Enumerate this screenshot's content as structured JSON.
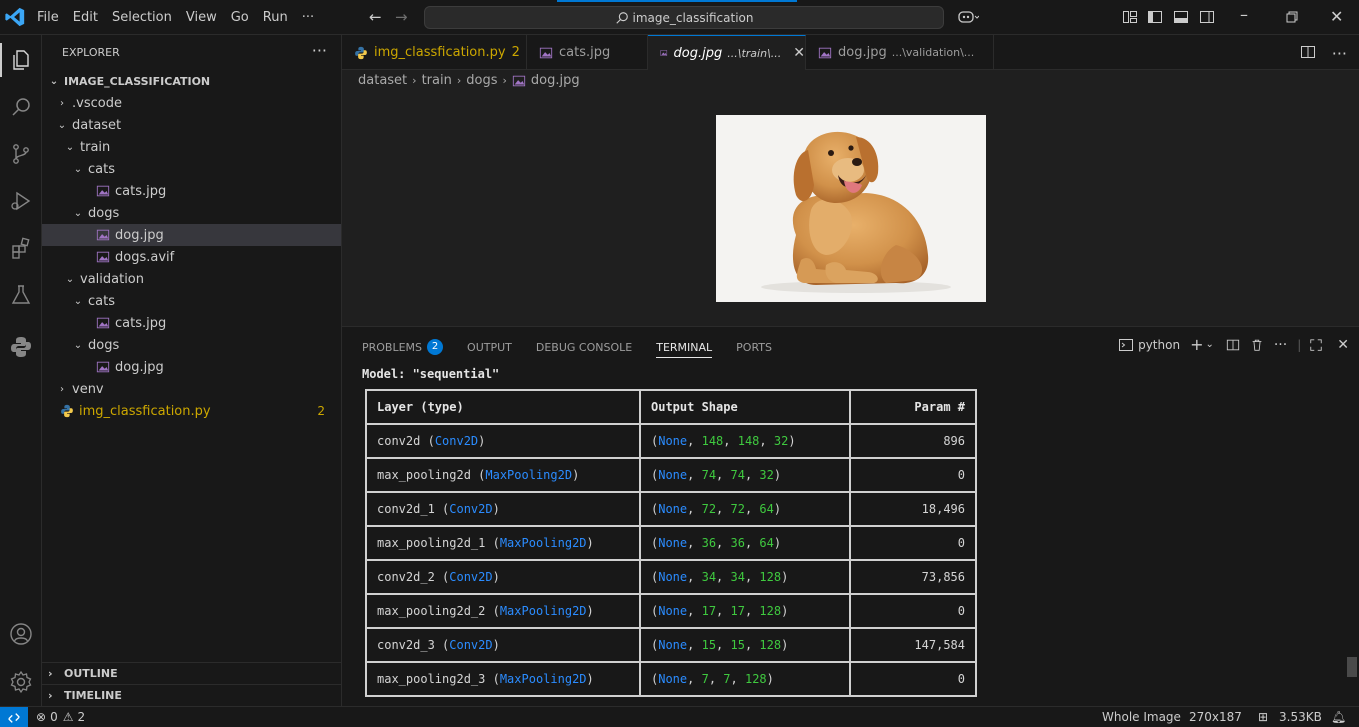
{
  "menu": [
    "File",
    "Edit",
    "Selection",
    "View",
    "Go",
    "Run",
    "···"
  ],
  "command_center": "image_classification",
  "explorer": {
    "header": "EXPLORER",
    "root": "IMAGE_CLASSIFICATION",
    "items": [
      {
        "label": ".vscode",
        "type": "folder",
        "open": false
      },
      {
        "label": "dataset",
        "type": "folder",
        "open": true
      },
      {
        "label": "train",
        "type": "folder",
        "open": true
      },
      {
        "label": "cats",
        "type": "folder",
        "open": true
      },
      {
        "label": "cats.jpg",
        "type": "image"
      },
      {
        "label": "dogs",
        "type": "folder",
        "open": true
      },
      {
        "label": "dog.jpg",
        "type": "image",
        "selected": true
      },
      {
        "label": "dogs.avif",
        "type": "image"
      },
      {
        "label": "validation",
        "type": "folder",
        "open": true
      },
      {
        "label": "cats",
        "type": "folder",
        "open": true
      },
      {
        "label": "cats.jpg",
        "type": "image"
      },
      {
        "label": "dogs",
        "type": "folder",
        "open": true
      },
      {
        "label": "dog.jpg",
        "type": "image"
      },
      {
        "label": "venv",
        "type": "folder",
        "open": false
      },
      {
        "label": "img_classfication.py",
        "type": "python",
        "problems": "2"
      }
    ],
    "outline": "OUTLINE",
    "timeline": "TIMELINE"
  },
  "tabs": [
    {
      "label": "img_classfication.py",
      "badge": "2",
      "color": "#cca700"
    },
    {
      "label": "cats.jpg"
    },
    {
      "label": "dog.jpg",
      "sub": "...\\train\\...",
      "active": true
    },
    {
      "label": "dog.jpg",
      "sub": "...\\validation\\..."
    }
  ],
  "breadcrumb": [
    "dataset",
    "train",
    "dogs",
    "dog.jpg"
  ],
  "panel": {
    "tabs": [
      "PROBLEMS",
      "OUTPUT",
      "DEBUG CONSOLE",
      "TERMINAL",
      "PORTS"
    ],
    "problems_count": "2",
    "terminal_name": "python"
  },
  "terminal": {
    "title": "Model: \"sequential\"",
    "headers": [
      "Layer (type)",
      "Output Shape",
      "Param #"
    ],
    "rows": [
      {
        "name": "conv2d",
        "type": "Conv2D",
        "shape": [
          "None",
          "148",
          "148",
          "32"
        ],
        "params": "896"
      },
      {
        "name": "max_pooling2d",
        "type": "MaxPooling2D",
        "shape": [
          "None",
          "74",
          "74",
          "32"
        ],
        "params": "0"
      },
      {
        "name": "conv2d_1",
        "type": "Conv2D",
        "shape": [
          "None",
          "72",
          "72",
          "64"
        ],
        "params": "18,496"
      },
      {
        "name": "max_pooling2d_1",
        "type": "MaxPooling2D",
        "shape": [
          "None",
          "36",
          "36",
          "64"
        ],
        "params": "0"
      },
      {
        "name": "conv2d_2",
        "type": "Conv2D",
        "shape": [
          "None",
          "34",
          "34",
          "128"
        ],
        "params": "73,856"
      },
      {
        "name": "max_pooling2d_2",
        "type": "MaxPooling2D",
        "shape": [
          "None",
          "17",
          "17",
          "128"
        ],
        "params": "0"
      },
      {
        "name": "conv2d_3",
        "type": "Conv2D",
        "shape": [
          "None",
          "15",
          "15",
          "128"
        ],
        "params": "147,584"
      },
      {
        "name": "max_pooling2d_3",
        "type": "MaxPooling2D",
        "shape": [
          "None",
          "7",
          "7",
          "128"
        ],
        "params": "0"
      }
    ]
  },
  "statusbar": {
    "errors": "0",
    "warnings": "2",
    "image_mode": "Whole Image",
    "dimensions": "270x187",
    "size": "3.53KB"
  },
  "colors": {
    "accent": "#0078d4",
    "warning": "#cca700",
    "terminal_blue": "#2b8cff",
    "terminal_green": "#3fc93f"
  }
}
